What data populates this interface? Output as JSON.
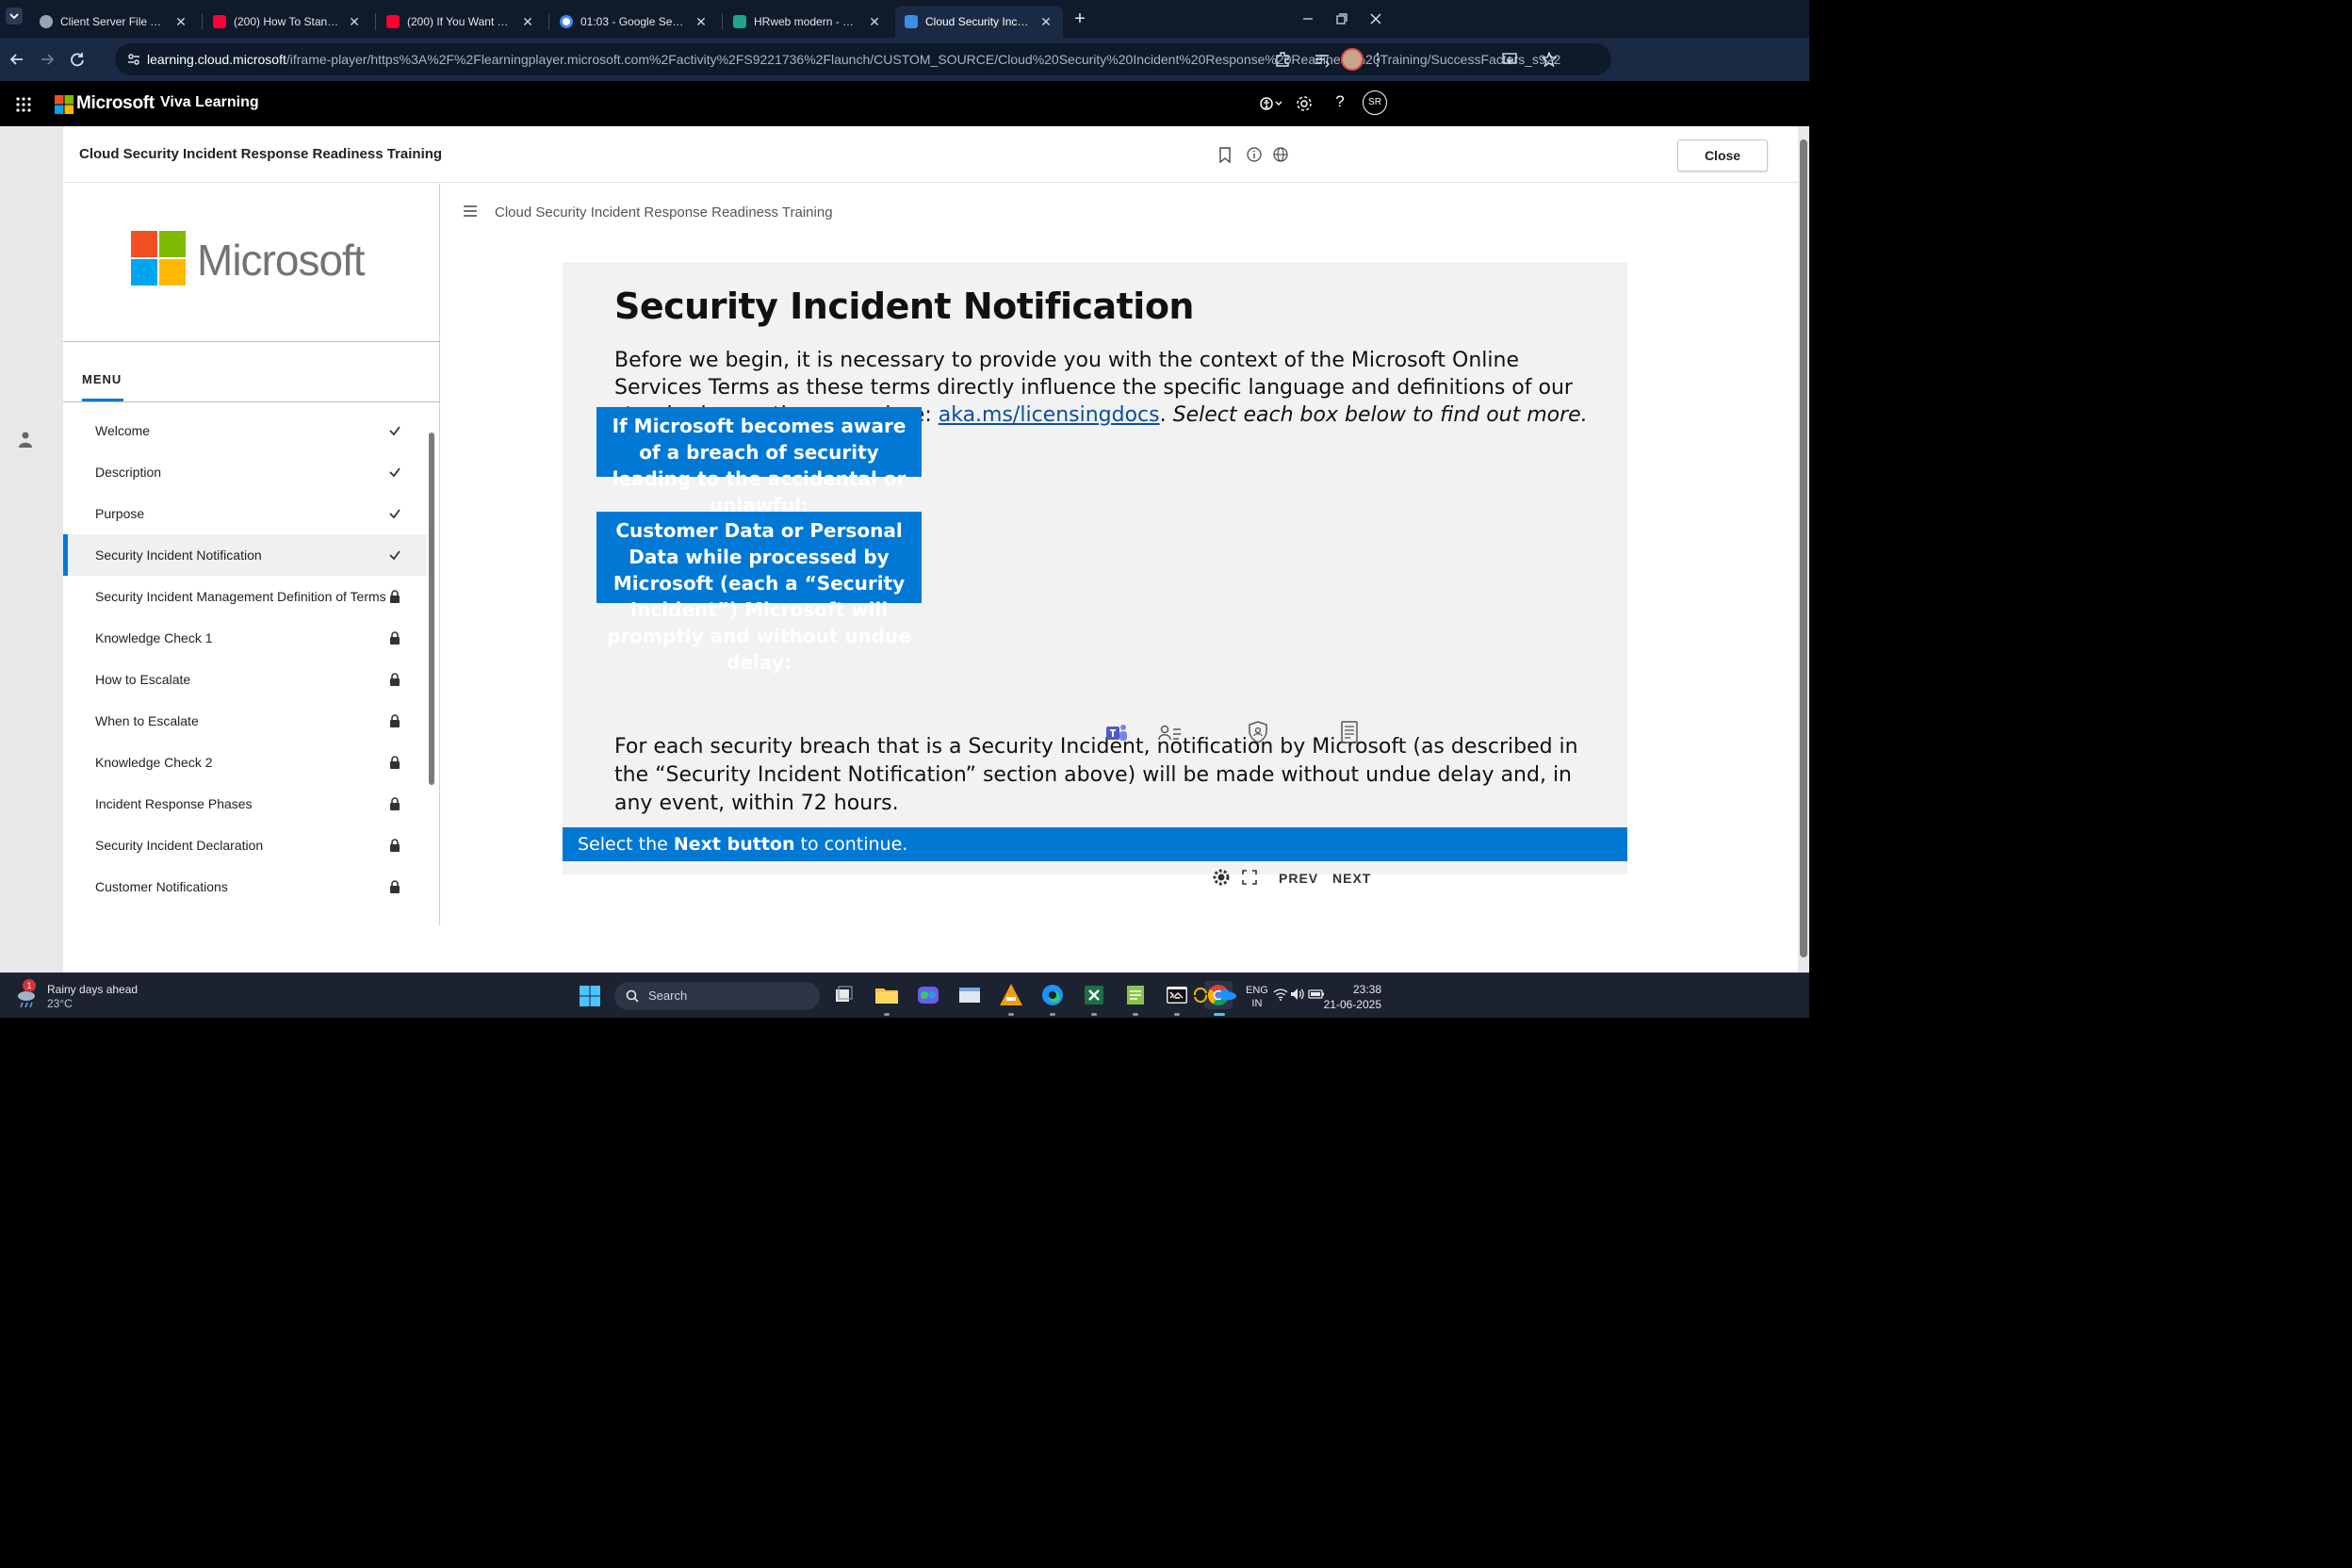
{
  "browser": {
    "tabs": [
      {
        "title": "Client Server File Transfer",
        "favicon_color": "#9aa3ad"
      },
      {
        "title": "(200) How To Stand Out Withou",
        "favicon_color": "#ff0033"
      },
      {
        "title": "(200) If You Want To Learn Fast",
        "favicon_color": "#ff0033"
      },
      {
        "title": "01:03 - Google Search",
        "favicon_color": "#ffffff"
      },
      {
        "title": "HRweb modern - Search",
        "favicon_color": "#1fa58a"
      },
      {
        "title": "Cloud Security Incident Respon",
        "favicon_color": "#3a8ee6"
      }
    ],
    "active_tab_index": 5,
    "new_tab_glyph": "+",
    "url_host": "learning.cloud.microsoft",
    "url_path": "/iframe-player/https%3A%2F%2Flearningplayer.microsoft.com%2Factivity%2FS9221736%2Flaunch/CUSTOM_SOURCE/Cloud%20Security%20Incident%20Response%20Readiness%20Training/SuccessFactors_s9221736/nul...",
    "window_buttons": [
      "minimize",
      "restore",
      "close"
    ],
    "profile_initials": "SR"
  },
  "app_header": {
    "brand": "Microsoft",
    "product": "Viva Learning",
    "user_initials": "SR"
  },
  "course": {
    "title": "Cloud Security Incident Response Readiness Training",
    "close_label": "Close"
  },
  "menu": {
    "label": "MENU",
    "logo_text": "Microsoft",
    "items": [
      {
        "label": "Welcome",
        "status": "complete"
      },
      {
        "label": "Description",
        "status": "complete"
      },
      {
        "label": "Purpose",
        "status": "complete"
      },
      {
        "label": "Security Incident Notification",
        "status": "complete",
        "selected": true
      },
      {
        "label": "Security Incident Management Definition of Terms",
        "status": "locked"
      },
      {
        "label": "Knowledge Check 1",
        "status": "locked"
      },
      {
        "label": "How to Escalate",
        "status": "locked"
      },
      {
        "label": "When to Escalate",
        "status": "locked"
      },
      {
        "label": "Knowledge Check 2",
        "status": "locked"
      },
      {
        "label": "Incident Response Phases",
        "status": "locked"
      },
      {
        "label": "Security Incident Declaration",
        "status": "locked"
      },
      {
        "label": "Customer Notifications",
        "status": "locked"
      }
    ]
  },
  "content": {
    "breadcrumb": "Cloud Security Incident Response Readiness Training",
    "slide_title": "Security Incident Notification",
    "intro_text": "Before we begin, it is necessary to provide you with the context of the Microsoft Online Services Terms as these terms directly influence the specific language and definitions of our standard operating procedure: ",
    "intro_link": "aka.ms/licensingdocs",
    "intro_after_link": ". ",
    "intro_italic": "Select each box below to find out more.",
    "box1": "If Microsoft becomes aware of a breach of security leading to the accidental or unlawful:",
    "box2": "Customer Data or Personal Data while processed by Microsoft (each a “Security Incident”) Microsoft will promptly and without undue delay:",
    "paragraph": "For each security breach that is a Security Incident, notification by Microsoft (as described in the “Security Incident Notification” section above) will be made without undue delay and, in any event, within 72 hours.",
    "next_bar_pre": "Select the ",
    "next_bar_bold": "Next button",
    "next_bar_post": " to continue.",
    "prev_label": "PREV",
    "next_label": "NEXT"
  },
  "taskbar": {
    "weather_title": "Rainy days ahead",
    "weather_temp": "23°C",
    "weather_badge": "1",
    "search_placeholder": "Search",
    "lang_line1": "ENG",
    "lang_line2": "IN",
    "time": "23:38",
    "date": "21-06-2025"
  },
  "colors": {
    "accent": "#0078d4",
    "tabbar": "#0f1a2b",
    "toolbar": "#1a2a44",
    "taskbar": "#1c2230"
  }
}
